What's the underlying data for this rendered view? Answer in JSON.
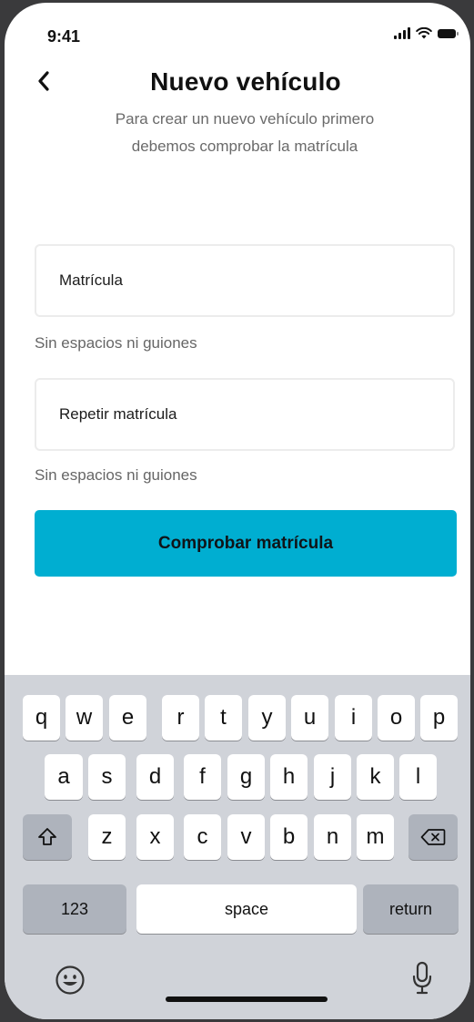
{
  "status_bar": {
    "time": "9:41"
  },
  "header": {
    "title": "Nuevo vehículo",
    "subtitle_line1": "Para crear un nuevo vehículo primero",
    "subtitle_line2": "debemos comprobar la matrícula"
  },
  "form": {
    "plate_placeholder": "Matrícula",
    "plate_hint": "Sin espacios ni guiones",
    "repeat_placeholder": "Repetir matrícula",
    "repeat_hint": "Sin espacios ni guiones",
    "submit_label": "Comprobar matrícula"
  },
  "keyboard": {
    "row1": [
      "q",
      "w",
      "e",
      "r",
      "t",
      "y",
      "u",
      "i",
      "o",
      "p"
    ],
    "row2": [
      "a",
      "s",
      "d",
      "f",
      "g",
      "h",
      "j",
      "k",
      "l"
    ],
    "row3": [
      "z",
      "x",
      "c",
      "v",
      "b",
      "n",
      "m"
    ],
    "numbers_label": "123",
    "space_label": "space",
    "return_label": "return",
    "icons": {
      "shift": "shift-arrow-icon",
      "delete": "backspace-icon",
      "emoji": "emoji-face-icon",
      "dictation": "microphone-icon"
    }
  },
  "colors": {
    "accent": "#00aed1",
    "keyboard_bg": "#d0d3d9",
    "func_key": "#aeb3bc"
  }
}
